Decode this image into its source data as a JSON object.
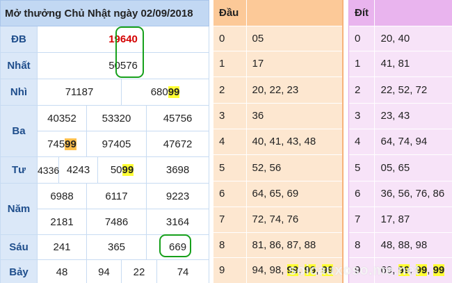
{
  "results": {
    "title": "Mở thưởng Chủ Nhật ngày 02/09/2018",
    "rows": [
      {
        "label": "ĐB",
        "values": [
          "19640"
        ]
      },
      {
        "label": "Nhất",
        "values": [
          "50576"
        ]
      },
      {
        "label": "Nhì",
        "values": [
          "71187",
          "68099"
        ]
      },
      {
        "label": "Ba",
        "values": [
          "40352",
          "53320",
          "45756",
          "74599",
          "97405",
          "47672"
        ]
      },
      {
        "label": "Tư",
        "values": [
          "4336",
          "4243",
          "5099",
          "3698"
        ]
      },
      {
        "label": "Năm",
        "values": [
          "6988",
          "6117",
          "9223",
          "2181",
          "7486",
          "3164"
        ]
      },
      {
        "label": "Sáu",
        "values": [
          "241",
          "365",
          "669"
        ]
      },
      {
        "label": "Bảy",
        "values": [
          "48",
          "94",
          "22",
          "74"
        ]
      }
    ],
    "parts": {
      "nhi_2_pre": "680",
      "nhi_2_hl": "99",
      "ba_4_pre": "745",
      "ba_4_hl": "99",
      "tu_3_pre": "50",
      "tu_3_hl": "99"
    }
  },
  "dau": {
    "header": [
      "Đầu",
      ""
    ],
    "rows": [
      {
        "k": "0",
        "v": "05"
      },
      {
        "k": "1",
        "v": "17"
      },
      {
        "k": "2",
        "v": "20, 22, 23"
      },
      {
        "k": "3",
        "v": "36"
      },
      {
        "k": "4",
        "v": "40, 41, 43, 48"
      },
      {
        "k": "5",
        "v": "52, 56"
      },
      {
        "k": "6",
        "v": "64, 65, 69"
      },
      {
        "k": "7",
        "v": "72, 74, 76"
      },
      {
        "k": "8",
        "v": "81, 86, 87, 88"
      },
      {
        "k": "9",
        "v_pre": "94, 98, ",
        "v_hl": [
          "99",
          "99",
          "99"
        ]
      }
    ]
  },
  "dit": {
    "header": [
      "Đít",
      ""
    ],
    "rows": [
      {
        "k": "0",
        "v": "20, 40"
      },
      {
        "k": "1",
        "v": "41, 81"
      },
      {
        "k": "2",
        "v": "22, 52, 72"
      },
      {
        "k": "3",
        "v": "23, 43"
      },
      {
        "k": "4",
        "v": "64, 74, 94"
      },
      {
        "k": "5",
        "v": "05, 65"
      },
      {
        "k": "6",
        "v": "36, 56, 76, 86"
      },
      {
        "k": "7",
        "v": "17, 87"
      },
      {
        "k": "8",
        "v": "48, 88, 98"
      },
      {
        "k": "9",
        "v_pre": "69, ",
        "v_hl": [
          "99",
          "99",
          "99"
        ]
      }
    ]
  },
  "watermark": "soicauxoso.me.net",
  "colors": {
    "highlight": "#ffff33",
    "circle": "#16a01b",
    "special": "#d40000"
  }
}
